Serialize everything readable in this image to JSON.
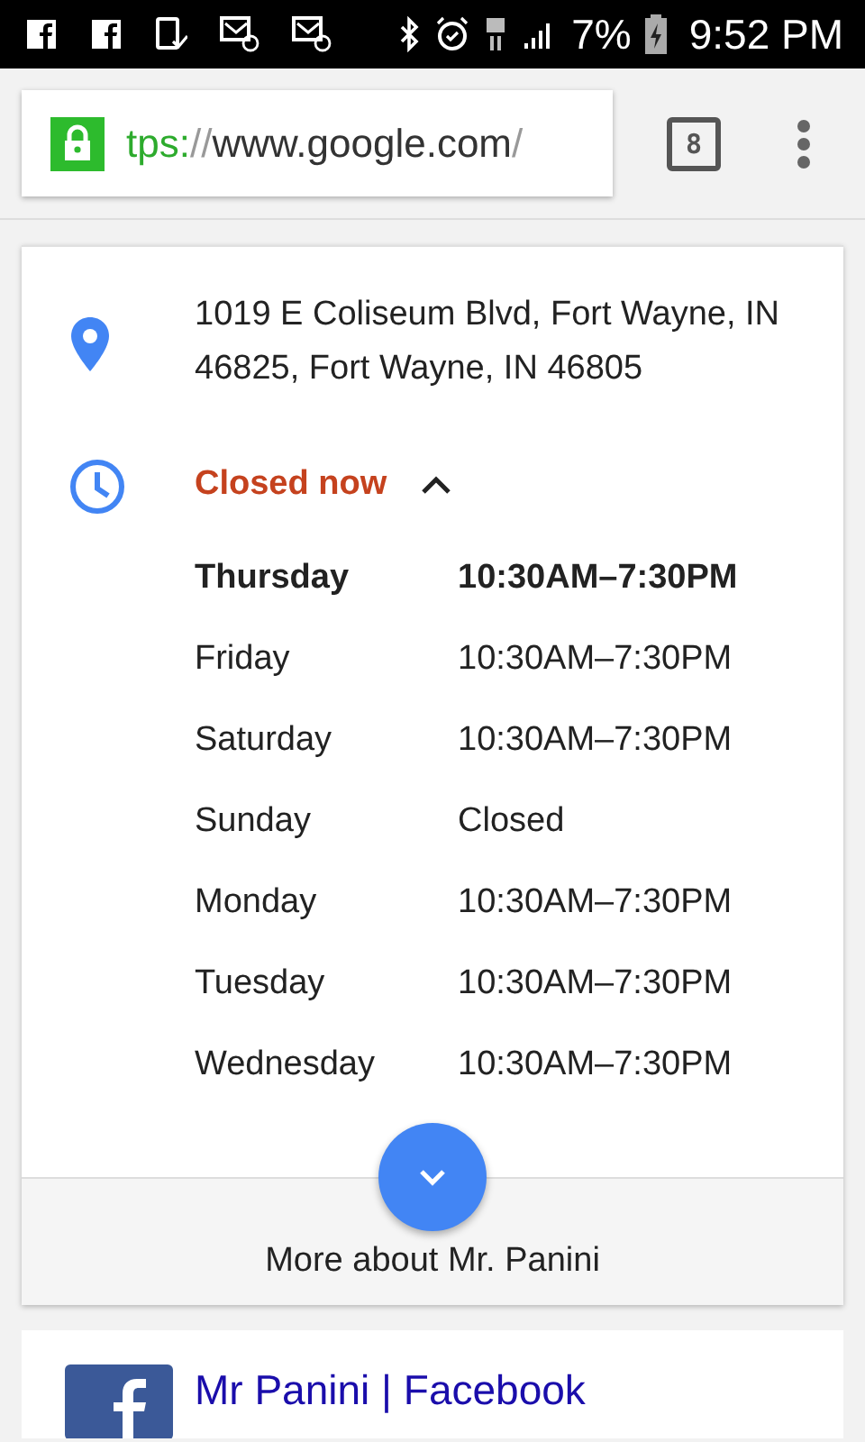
{
  "status_bar": {
    "battery": "7%",
    "time": "9:52 PM"
  },
  "browser": {
    "url_parts": [
      {
        "text": "tps:",
        "kind": "scheme"
      },
      {
        "text": "//",
        "kind": "separator"
      },
      {
        "text": "www.google.com",
        "kind": "host"
      },
      {
        "text": "/",
        "kind": "separator"
      }
    ],
    "tab_count": "8"
  },
  "place": {
    "address": "1019 E Coliseum Blvd, Fort Wayne, IN 46825, Fort Wayne, IN 46805",
    "status": "Closed now",
    "hours_expanded": true,
    "hours": [
      {
        "day": "Thursday",
        "time": "10:30AM–7:30PM",
        "today": true
      },
      {
        "day": "Friday",
        "time": "10:30AM–7:30PM",
        "today": false
      },
      {
        "day": "Saturday",
        "time": "10:30AM–7:30PM",
        "today": false
      },
      {
        "day": "Sunday",
        "time": "Closed",
        "today": false
      },
      {
        "day": "Monday",
        "time": "10:30AM–7:30PM",
        "today": false
      },
      {
        "day": "Tuesday",
        "time": "10:30AM–7:30PM",
        "today": false
      },
      {
        "day": "Wednesday",
        "time": "10:30AM–7:30PM",
        "today": false
      }
    ],
    "more_label": "More about Mr. Panini"
  },
  "result": {
    "title": "Mr Panini | Facebook"
  }
}
